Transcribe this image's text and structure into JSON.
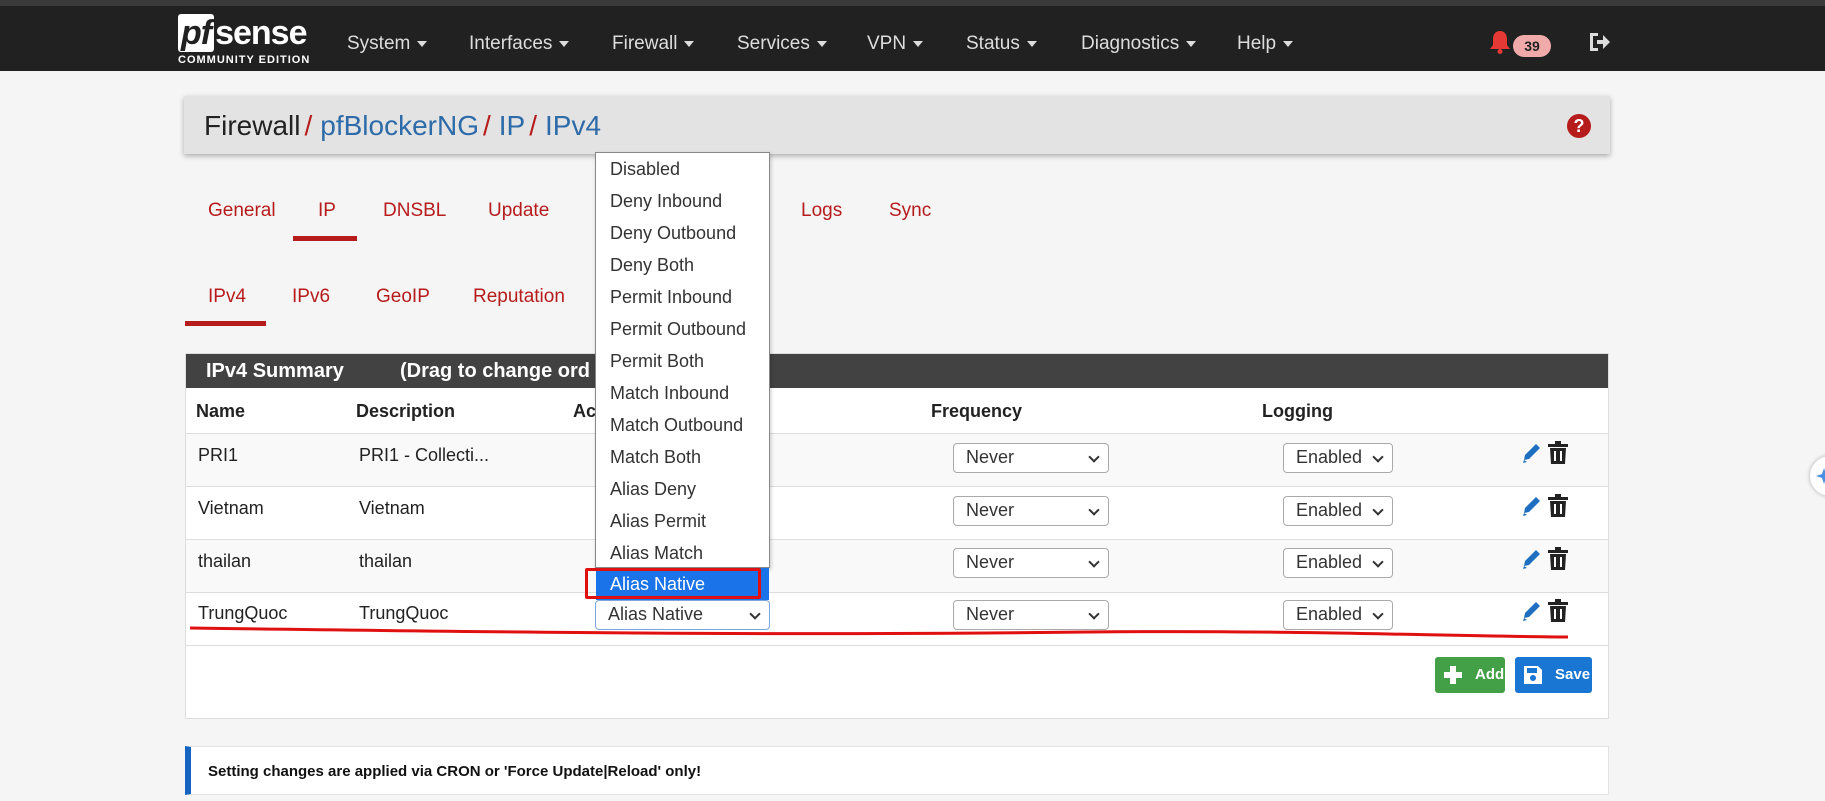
{
  "navbar": {
    "logo_pf": "pf",
    "logo_sense": "sense",
    "edition": "COMMUNITY EDITION",
    "menus": [
      "System",
      "Interfaces",
      "Firewall",
      "Services",
      "VPN",
      "Status",
      "Diagnostics",
      "Help"
    ],
    "notification_count": "39"
  },
  "breadcrumb": {
    "root": "Firewall",
    "items": [
      "pfBlockerNG",
      "IP",
      "IPv4"
    ]
  },
  "help_label": "?",
  "tabs": [
    "General",
    "IP",
    "DNSBL",
    "Update",
    "Logs",
    "Sync"
  ],
  "subtabs": [
    "IPv4",
    "IPv6",
    "GeoIP",
    "Reputation"
  ],
  "panel": {
    "title": "IPv4 Summary",
    "subtitle": "(Drag to change ord"
  },
  "table": {
    "headers": [
      "Name",
      "Description",
      "Ac",
      "Frequency",
      "Logging"
    ],
    "rows": [
      {
        "name": "PRI1",
        "description": "PRI1 - Collecti...",
        "frequency": "Never",
        "logging": "Enabled"
      },
      {
        "name": "Vietnam",
        "description": "Vietnam",
        "frequency": "Never",
        "logging": "Enabled"
      },
      {
        "name": "thailan",
        "description": "thailan",
        "frequency": "Never",
        "logging": "Enabled"
      },
      {
        "name": "TrungQuoc",
        "description": "TrungQuoc",
        "action": "Alias Native",
        "frequency": "Never",
        "logging": "Enabled"
      }
    ]
  },
  "buttons": {
    "add": "Add",
    "save": "Save"
  },
  "info_text": "Setting changes are applied via CRON or 'Force Update|Reload' only!",
  "action_dropdown": {
    "options": [
      "Disabled",
      "Deny Inbound",
      "Deny Outbound",
      "Deny Both",
      "Permit Inbound",
      "Permit Outbound",
      "Permit Both",
      "Match Inbound",
      "Match Outbound",
      "Match Both",
      "Alias Deny",
      "Alias Permit",
      "Alias Match",
      "Alias Native"
    ],
    "highlighted": "Alias Native"
  },
  "colors": {
    "accent_red": "#b71c1c",
    "link_blue": "#2d6ba9",
    "navbar": "#212121",
    "add_green": "#43a047",
    "save_blue": "#1976d2",
    "highlight_blue": "#1a73e8",
    "annotation_red": "#e01010"
  }
}
